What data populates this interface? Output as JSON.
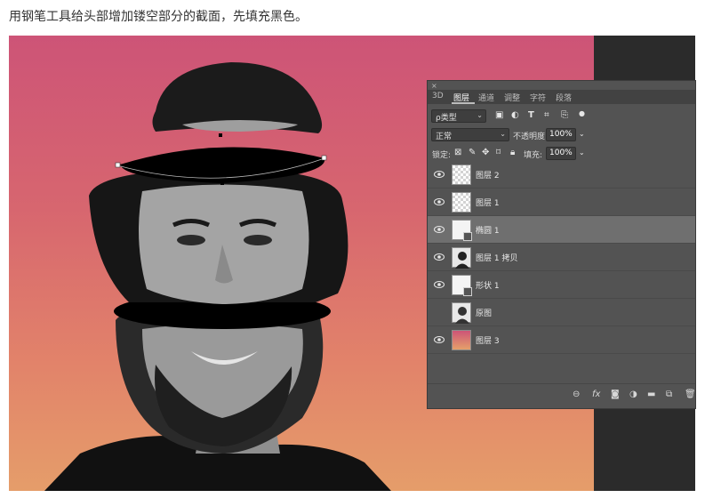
{
  "caption": "用钢笔工具给头部增加镂空部分的截面，先填充黑色。",
  "colors": {
    "gradient_top": "#cd5477",
    "gradient_bottom": "#e59d6a",
    "panel_bg": "#535353",
    "selected_row": "#6f6f6f"
  },
  "panel": {
    "close_glyph": "×",
    "tabs": [
      {
        "label": "3D",
        "active": false
      },
      {
        "label": "图层",
        "active": true
      },
      {
        "label": "通道",
        "active": false
      },
      {
        "label": "调整",
        "active": false
      },
      {
        "label": "字符",
        "active": false
      },
      {
        "label": "段落",
        "active": false
      }
    ],
    "filter": {
      "label": "ρ类型",
      "icons": [
        "image-filter-icon",
        "adjustment-filter-icon",
        "type-filter-icon",
        "shape-filter-icon",
        "smart-object-filter-icon",
        "filter-toggle-icon"
      ]
    },
    "blend_mode": "正常",
    "opacity_label": "不透明度:",
    "opacity_value": "100%",
    "lock_label": "锁定:",
    "lock_icons": [
      "lock-transparent-icon",
      "lock-paint-icon",
      "lock-position-icon",
      "lock-artboard-icon",
      "lock-all-icon"
    ],
    "fill_label": "填充:",
    "fill_value": "100%",
    "layers": [
      {
        "name": "图层 2",
        "visible": true,
        "selected": false,
        "thumb": "checker"
      },
      {
        "name": "图层 1",
        "visible": true,
        "selected": false,
        "thumb": "checker"
      },
      {
        "name": "椭圆 1",
        "visible": true,
        "selected": true,
        "thumb": "white"
      },
      {
        "name": "图层 1 拷贝",
        "visible": true,
        "selected": false,
        "thumb": "photo"
      },
      {
        "name": "形状 1",
        "visible": true,
        "selected": false,
        "thumb": "white"
      },
      {
        "name": "原图",
        "visible": false,
        "selected": false,
        "thumb": "photo"
      },
      {
        "name": "图层 3",
        "visible": true,
        "selected": false,
        "thumb": "gradient"
      }
    ],
    "footer_icons": [
      "link-layers-icon",
      "fx-icon",
      "layer-mask-icon",
      "adjustment-layer-icon",
      "group-folder-icon",
      "new-layer-icon",
      "trash-icon"
    ],
    "footer_fx": "fx"
  }
}
